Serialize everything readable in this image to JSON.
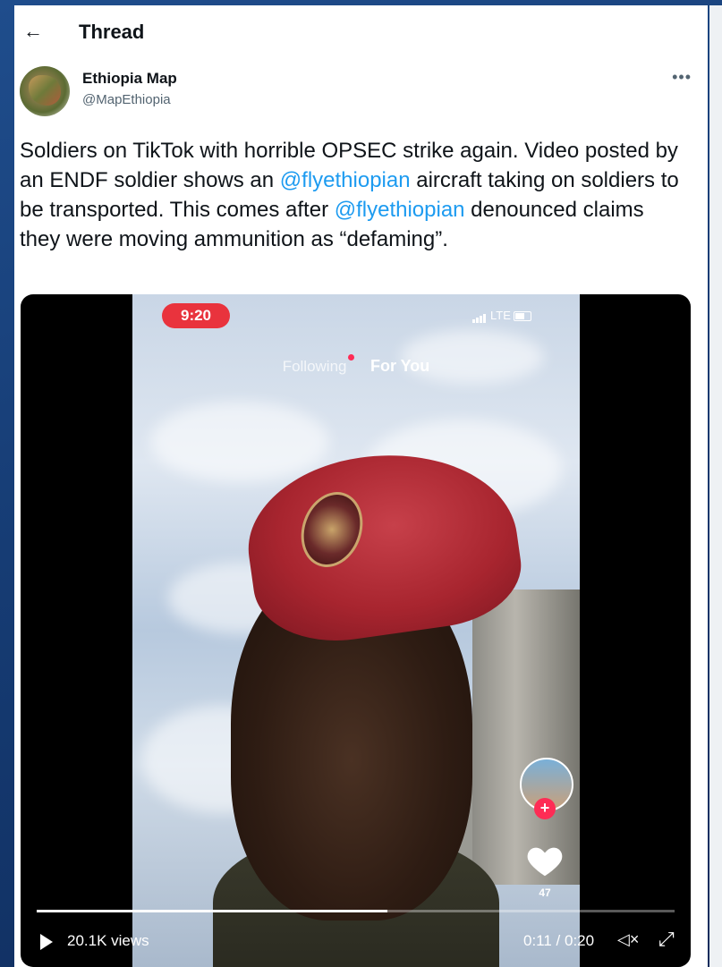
{
  "header": {
    "back_icon": "back-arrow-icon",
    "title": "Thread"
  },
  "tweet": {
    "author": {
      "display_name": "Ethiopia Map",
      "handle": "@MapEthiopia"
    },
    "text_parts": [
      "Soldiers on TikTok with horrible OPSEC strike again. Video posted by an ENDF soldier shows an ",
      "@flyethiopian",
      " aircraft taking on soldiers to be transported. This comes after ",
      "@flyethiopian",
      " denounced claims they were moving ammunition as “defaming”."
    ]
  },
  "video": {
    "phone_time": "9:20",
    "network": "LTE",
    "tab_following": "Following",
    "tab_for_you": "For You",
    "likes": "47",
    "views": "20.1K views",
    "timecode": "0:11 / 0:20",
    "progress": 0.55
  }
}
